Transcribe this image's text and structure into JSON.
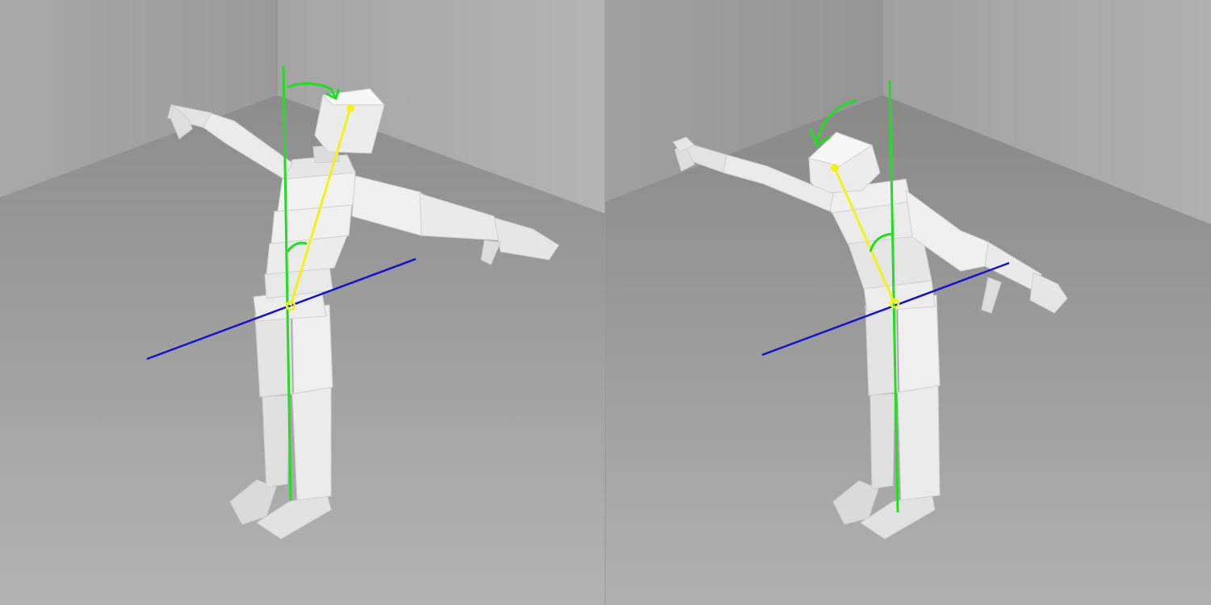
{
  "views": [
    {
      "id": "view-left",
      "pose": "upright-tilt",
      "head_rotation_arrow": "clockwise"
    },
    {
      "id": "view-right",
      "pose": "forward-lean",
      "head_rotation_arrow": "counter-clockwise"
    }
  ],
  "colors": {
    "vertical_axis": "#22dd22",
    "spine_line": "#f2f21a",
    "hip_axis": "#1515c8",
    "annotation_arc": "#22dd22",
    "figure": "#e6e6e6",
    "floor": "#9c9c9c",
    "wall": "#a4a4a4"
  }
}
